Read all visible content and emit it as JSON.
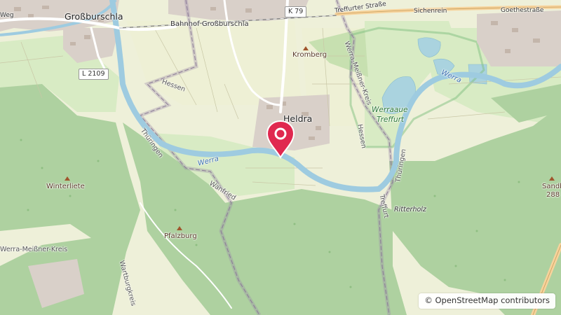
{
  "labels": {
    "grossburschla": "Großburschla",
    "bahnhof": "Bahnhof Großburschla",
    "k79": "K 79",
    "treffurter_strasse": "Treffurter Straße",
    "sichenrein": "Sichenrein",
    "goethestrasse": "Goethestraße",
    "l2109": "L 2109",
    "kromberg": "Kromberg",
    "hessen_1": "Hessen",
    "hessen_2": "Hessen",
    "heldra": "Heldra",
    "werra_meissner_1": "Werra-Meißner-Kreis",
    "werra_meissner_2": "Werra-Meißner-Kreis",
    "werra_1": "Werra",
    "werra_2": "Werra",
    "werraaue_1": "Werraaue",
    "werraaue_2": "Treffurt",
    "thueringen_1": "Thüringen",
    "thueringen_2": "Thüringen",
    "wanfried": "Wanfried",
    "winterliete": "Winterliete",
    "pfalzburg": "Pfalzburg",
    "ritterholz": "Ritterholz",
    "treffurt": "Treffurt",
    "sandberg": "Sandb",
    "sandberg_ele": "288",
    "weg": "Weg",
    "eisenach": "Wartburgkreis"
  },
  "attribution": {
    "symbol": "©",
    "text": "OpenStreetMap contributors"
  },
  "colors": {
    "forest": "#aed1a0",
    "water": "#aad3df",
    "river": "#9ecbe0",
    "marker": "#e0284f",
    "border": "#9c8aa8"
  },
  "icons": {
    "marker": "map-pin-icon",
    "peak": "peak-icon"
  }
}
